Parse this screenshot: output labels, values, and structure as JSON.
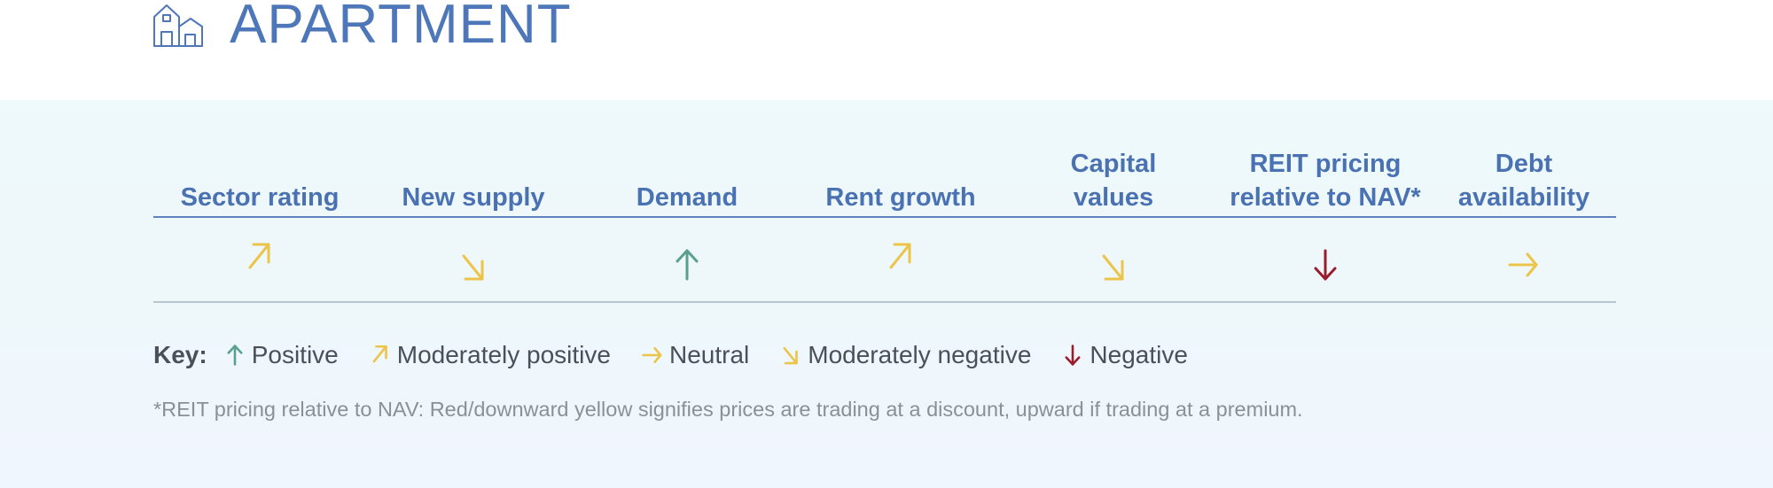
{
  "header": {
    "icon": "houses-icon",
    "title": "APARTMENT"
  },
  "colors": {
    "title_blue": "#4e77b9",
    "positive": "#5a9f90",
    "moderate": "#ecc44a",
    "negative": "#9b1c2b",
    "key_text": "#4b5058",
    "footnote_text": "#8a9096"
  },
  "columns": [
    {
      "label_lines": [
        "Sector rating"
      ],
      "rating": "moderately-positive"
    },
    {
      "label_lines": [
        "New supply"
      ],
      "rating": "moderately-negative"
    },
    {
      "label_lines": [
        "Demand"
      ],
      "rating": "positive"
    },
    {
      "label_lines": [
        "Rent growth"
      ],
      "rating": "moderately-positive"
    },
    {
      "label_lines": [
        "Capital",
        "values"
      ],
      "rating": "moderately-negative"
    },
    {
      "label_lines": [
        "REIT pricing",
        "relative to NAV*"
      ],
      "rating": "negative"
    },
    {
      "label_lines": [
        "Debt",
        "availability"
      ],
      "rating": "neutral"
    }
  ],
  "key": {
    "label": "Key:",
    "items": [
      {
        "rating": "positive",
        "label": "Positive",
        "icon": "arrow-up-icon"
      },
      {
        "rating": "moderately-positive",
        "label": "Moderately positive",
        "icon": "arrow-up-right-icon"
      },
      {
        "rating": "neutral",
        "label": "Neutral",
        "icon": "arrow-right-icon"
      },
      {
        "rating": "moderately-negative",
        "label": "Moderately negative",
        "icon": "arrow-down-right-icon"
      },
      {
        "rating": "negative",
        "label": "Negative",
        "icon": "arrow-down-icon"
      }
    ]
  },
  "footnote": "*REIT pricing relative to NAV: Red/downward yellow signifies prices are trading at a discount, upward if trading at a premium."
}
